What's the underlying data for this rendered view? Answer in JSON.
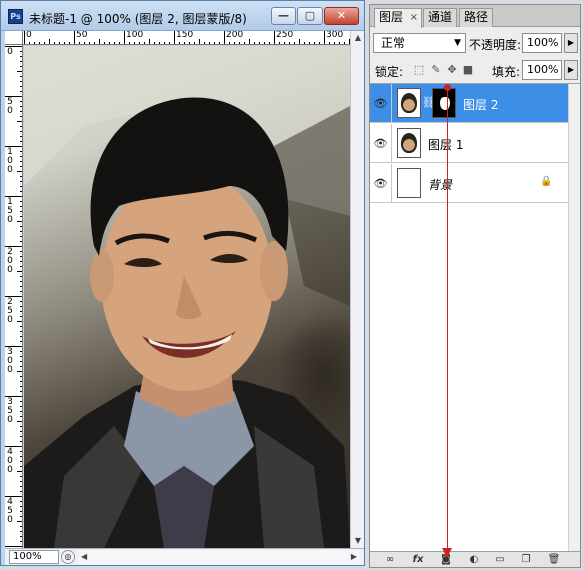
{
  "document": {
    "title": "未标题-1 @ 100% (图层 2, 图层蒙版/8)",
    "app_icon_text": "Ps",
    "zoom": "100%",
    "ruler_top_labels": [
      "0",
      "50",
      "100",
      "150",
      "200",
      "250",
      "300"
    ],
    "ruler_left_labels": [
      "0",
      "5\n0",
      "1\n0\n0",
      "1\n5\n0",
      "2\n0\n0",
      "2\n5\n0",
      "3\n0\n0",
      "3\n5\n0",
      "4\n0\n0",
      "4\n5\n0"
    ]
  },
  "window_buttons": {
    "minimize": "—",
    "maximize": "▢",
    "close": "✕"
  },
  "panel": {
    "tabs": [
      {
        "label": "图层",
        "close": "×"
      },
      {
        "label": "通道"
      },
      {
        "label": "路径"
      }
    ],
    "blend_mode": "正常",
    "opacity_label": "不透明度:",
    "opacity_value": "100%",
    "lock_label": "锁定:",
    "fill_label": "填充:",
    "fill_value": "100%",
    "layers": [
      {
        "name": "图层 2",
        "selected": true,
        "has_mask": true
      },
      {
        "name": "图层 1",
        "selected": false,
        "has_mask": false
      },
      {
        "name": "背景",
        "selected": false,
        "has_mask": false,
        "locked": true
      }
    ]
  },
  "icons": {
    "eye": "eye-icon",
    "link": "link-icon",
    "fx": "fx-icon",
    "mask": "add-mask-icon",
    "adjustment": "adjustment-layer-icon",
    "group": "group-icon",
    "new_layer": "new-layer-icon",
    "trash": "trash-icon"
  },
  "annotation": {
    "arrow_color": "#d0202a"
  }
}
